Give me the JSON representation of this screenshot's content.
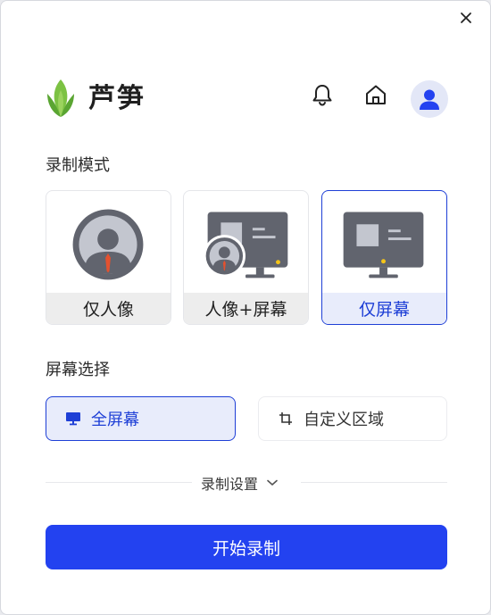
{
  "app": {
    "brand": "芦笋"
  },
  "header": {
    "icons": [
      "bell-icon",
      "home-icon",
      "user-avatar-icon"
    ]
  },
  "record_mode": {
    "title": "录制模式",
    "options": [
      {
        "label": "仅人像",
        "selected": false
      },
      {
        "label": "人像+屏幕",
        "selected": false
      },
      {
        "label": "仅屏幕",
        "selected": true
      }
    ]
  },
  "screen_select": {
    "title": "屏幕选择",
    "options": [
      {
        "label": "全屏幕",
        "icon": "monitor-icon",
        "selected": true
      },
      {
        "label": "自定义区域",
        "icon": "crop-icon",
        "selected": false
      }
    ]
  },
  "settings": {
    "label": "录制设置"
  },
  "start": {
    "label": "开始录制"
  },
  "colors": {
    "accent": "#2342f0",
    "selected_border": "#1e3fd6",
    "selected_bg": "#e8ecfb"
  }
}
